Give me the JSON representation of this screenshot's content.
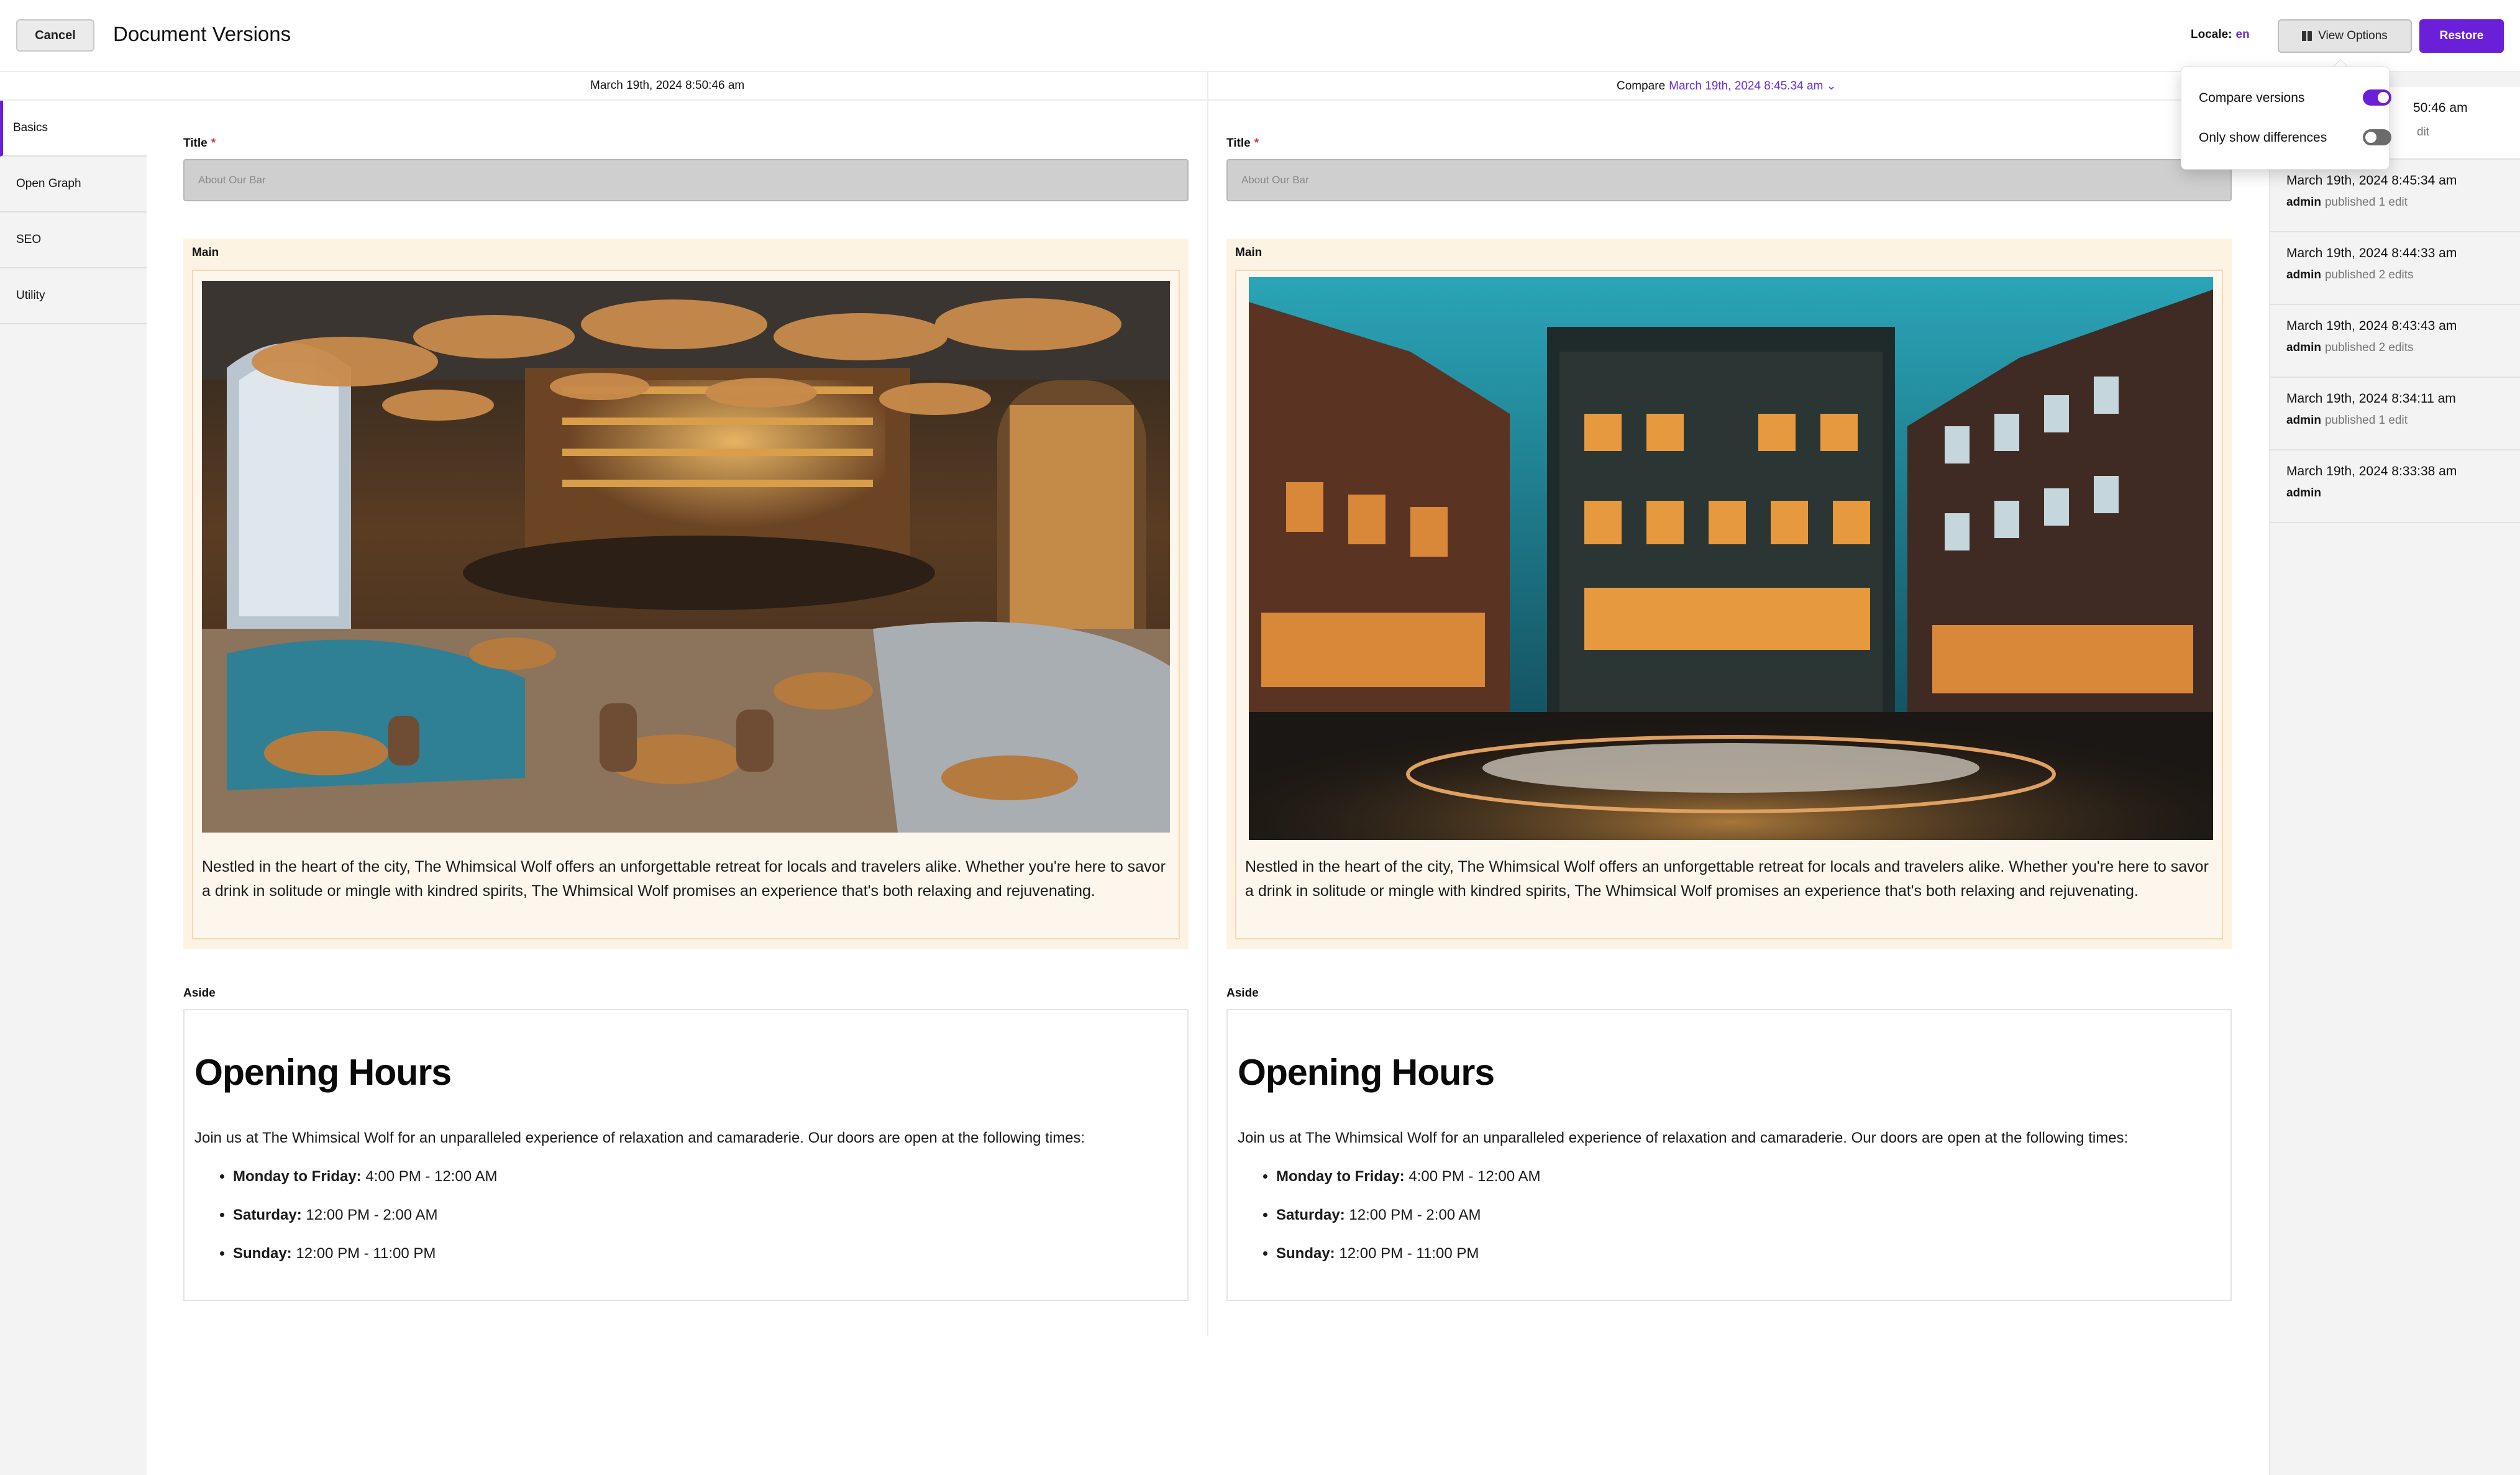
{
  "header": {
    "cancel_label": "Cancel",
    "title": "Document Versions",
    "locale_label": "Locale:",
    "locale_value": "en",
    "view_options_label": "View Options",
    "restore_label": "Restore"
  },
  "subheader": {
    "current_version_date": "March 19th, 2024 8:50:46 am",
    "compare_label": "Compare",
    "compare_version_date": "March 19th, 2024 8:45.34 am",
    "compare_chevron": "⌄"
  },
  "sidebar": {
    "items": [
      {
        "label": "Basics",
        "active": true
      },
      {
        "label": "Open Graph",
        "active": false
      },
      {
        "label": "SEO",
        "active": false
      },
      {
        "label": "Utility",
        "active": false
      }
    ]
  },
  "fields": {
    "title_label": "Title",
    "required_mark": "*",
    "title_placeholder": "About Our Bar",
    "main_label": "Main",
    "aside_label": "Aside"
  },
  "left_version": {
    "main_text": "Nestled in the heart of the city, The Whimsical Wolf offers an unforgettable retreat for locals and travelers alike. Whether you're here to savor a drink in solitude or mingle with kindred spirits, The Whimsical Wolf promises an experience that's both relaxing and rejuvenating.",
    "image_desc": "bar-interior-image"
  },
  "right_version": {
    "main_text": "Nestled in the heart of the city, The Whimsical Wolf offers an unforgettable retreat for locals and travelers alike. Whether you're here to savor a drink in solitude or mingle with kindred spirits, The Whimsical Wolf promises an experience that's both relaxing and rejuvenating.",
    "image_desc": "bar-exterior-image"
  },
  "aside": {
    "title": "Opening Hours",
    "intro": "Join us at The Whimsical Wolf for an unparalleled experience of relaxation and camaraderie. Our doors are open at the following times:",
    "hours": [
      {
        "day": "Monday to Friday:",
        "time": " 4:00 PM - 12:00 AM"
      },
      {
        "day": "Saturday:",
        "time": " 12:00 PM - 2:00 AM"
      },
      {
        "day": "Sunday:",
        "time": " 12:00 PM - 11:00 PM"
      }
    ]
  },
  "view_options": {
    "compare_versions_label": "Compare versions",
    "compare_versions_on": true,
    "only_differences_label": "Only show differences",
    "only_differences_on": false
  },
  "versions": [
    {
      "date": "50:46 am",
      "user": "",
      "status": "dit"
    },
    {
      "date": "March 19th, 2024 8:45:34 am",
      "user": "admin",
      "status": "published 1 edit"
    },
    {
      "date": "March 19th, 2024 8:44:33 am",
      "user": "admin",
      "status": "published 2 edits"
    },
    {
      "date": "March 19th, 2024 8:43:43 am",
      "user": "admin",
      "status": "published 2 edits"
    },
    {
      "date": "March 19th, 2024 8:34:11 am",
      "user": "admin",
      "status": "published 1 edit"
    },
    {
      "date": "March 19th, 2024 8:33:38 am",
      "user": "admin",
      "status": ""
    }
  ],
  "colors": {
    "accent": "#6a1fd8",
    "link": "#6a2fd9",
    "main_bg": "#fdf3e3"
  }
}
